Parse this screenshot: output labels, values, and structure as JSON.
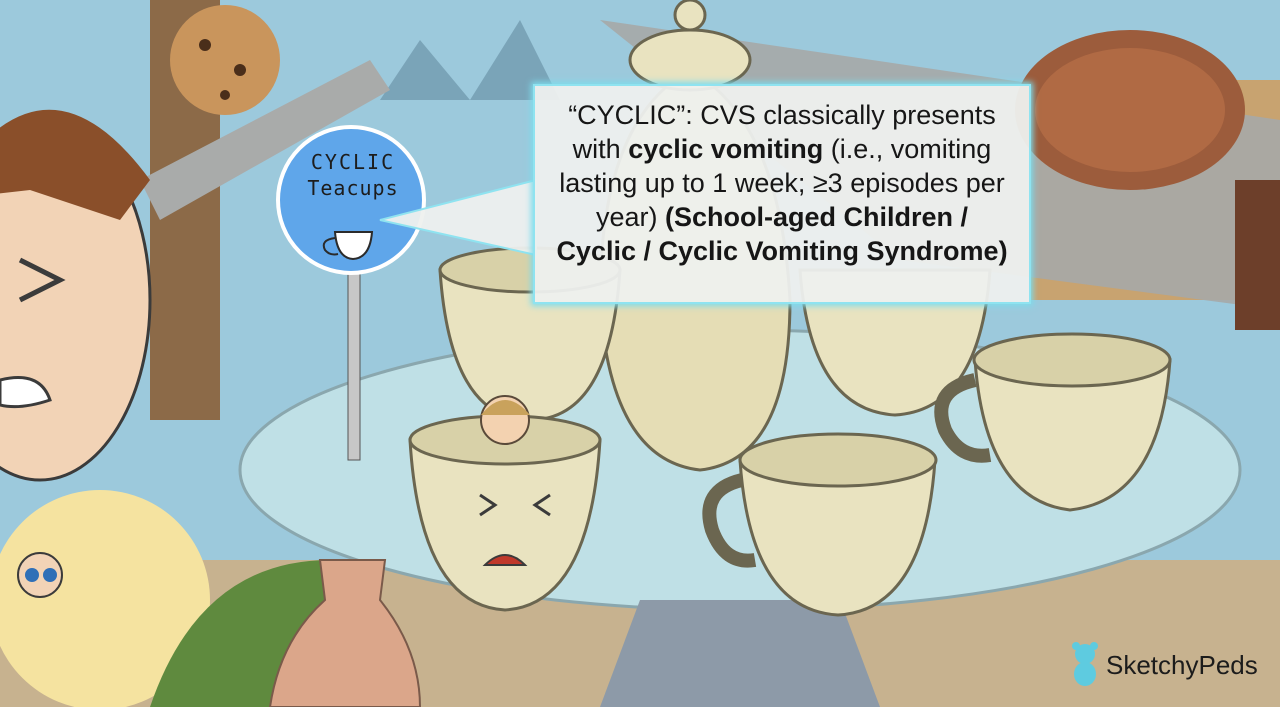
{
  "callout": {
    "segments": [
      {
        "text": "“CYCLIC”: CVS classically presents with ",
        "bold": false
      },
      {
        "text": "cyclic vomiting",
        "bold": true
      },
      {
        "text": " (i.e., vomiting lasting up to 1 week; ≥3 episodes per year) ",
        "bold": false
      },
      {
        "text": "(School-aged Children / Cyclic / Cyclic Vomiting Syndrome)",
        "bold": true
      }
    ]
  },
  "sign": {
    "line1": "CYCLIC",
    "line2": "Teacups"
  },
  "brand": {
    "name": "SketchyPeds",
    "icon": "teddy-bear-icon",
    "accent": "#5ecbe0"
  },
  "colors": {
    "sky": "#9cc9dc",
    "table_glass": "#b8dde6",
    "cup": "#e9e3c0",
    "cup_shadow": "#bfb68b",
    "wood": "#c69b64",
    "tent": "#a6a8a7"
  }
}
